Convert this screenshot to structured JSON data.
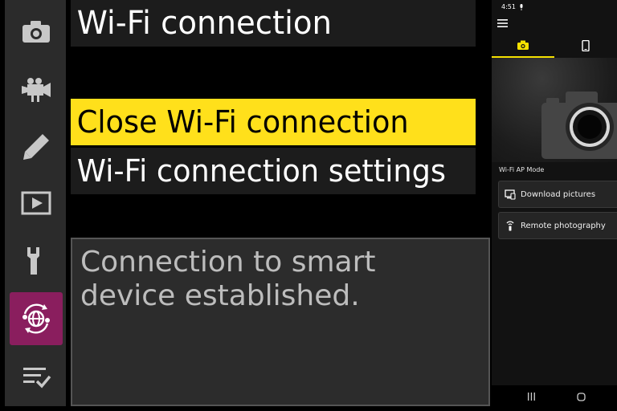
{
  "camera_menu": {
    "title": "Wi-Fi connection",
    "items": [
      {
        "label": "Close Wi-Fi connection",
        "selected": true
      },
      {
        "label": "Wi-Fi connection settings",
        "selected": false
      }
    ],
    "info_lines": [
      "Connection to smart",
      "device established."
    ],
    "side_tabs": [
      "camera-icon",
      "movie-camera-icon",
      "pencil-icon",
      "playback-icon",
      "wrench-icon",
      "network-icon",
      "my-menu-icon"
    ],
    "active_tab": "network-icon",
    "colors": {
      "highlight": "#ffe01b",
      "active_tab": "#8a1e5e"
    }
  },
  "phone": {
    "status_time": "4:51",
    "tabs": [
      "camera-icon",
      "smartphone-icon"
    ],
    "active_tab": "camera-icon",
    "mode_label": "Wi-Fi AP Mode",
    "actions": [
      {
        "label": "Download pictures",
        "icon": "download-pictures-icon"
      },
      {
        "label": "Remote photography",
        "icon": "remote-shutter-icon"
      }
    ],
    "nav": [
      "recent-apps-icon",
      "home-icon"
    ],
    "colors": {
      "accent": "#f5e100"
    }
  }
}
